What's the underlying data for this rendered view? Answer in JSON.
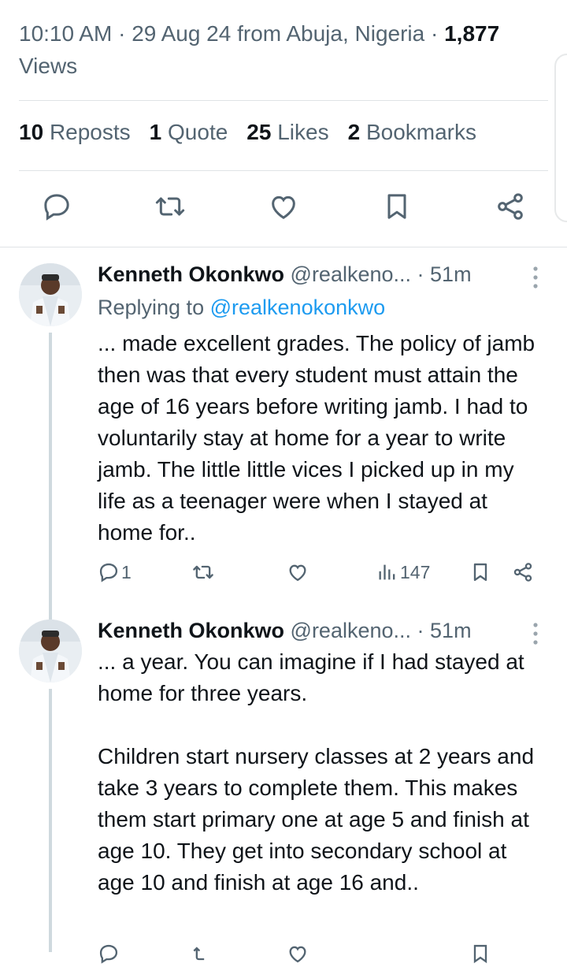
{
  "tweet_meta": {
    "time": "10:10 AM",
    "date": "29 Aug 24",
    "location": "from Abuja, Nigeria",
    "views_count": "1,877",
    "views_label": "Views"
  },
  "stats": {
    "reposts_count": "10",
    "reposts_label": "Reposts",
    "quotes_count": "1",
    "quotes_label": "Quote",
    "likes_count": "25",
    "likes_label": "Likes",
    "bookmarks_count": "2",
    "bookmarks_label": "Bookmarks"
  },
  "action_icons": [
    "reply-icon",
    "repost-icon",
    "like-icon",
    "bookmark-icon",
    "share-icon"
  ],
  "replies": [
    {
      "name": "Kenneth Okonkwo",
      "handle": "@realkeno...",
      "time": "51m",
      "replying_prefix": "Replying to",
      "replying_to": "@realkenokonkwo",
      "text": "... made excellent grades. The policy of jamb then was that every student must attain the age of 16 years before writing jamb. I had to voluntarily stay at home for a year to write jamb. The little little vices I picked up in my life as a teenager were when I stayed at home for..",
      "reply_count": "1",
      "views": "147"
    },
    {
      "name": "Kenneth Okonkwo",
      "handle": "@realkeno...",
      "time": "51m",
      "text": "... a year. You can imagine if I had stayed at home for three years.\n\nChildren start nursery classes at 2 years and take 3 years to complete them. This makes them start primary one at age 5 and finish at age 10. They get into secondary school at age 10 and finish at age 16 and.."
    }
  ],
  "colors": {
    "text": "#0f1419",
    "secondary": "#536471",
    "link": "#1d9bf0",
    "divider": "#dfe3e6"
  }
}
